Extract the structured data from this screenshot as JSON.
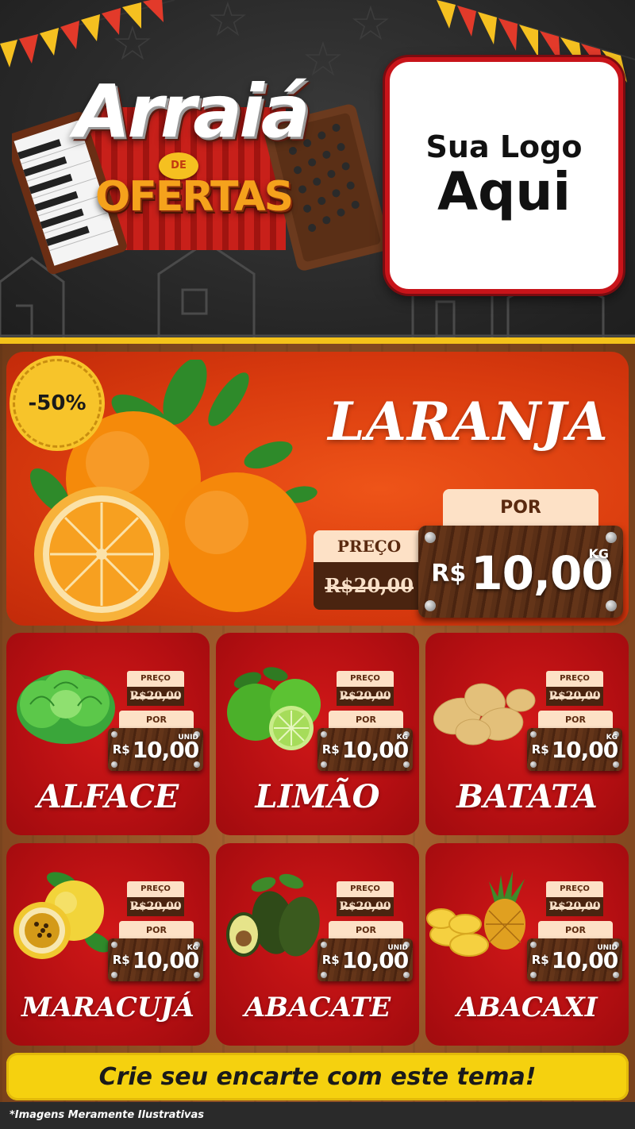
{
  "header": {
    "title_line1": "Arraiá",
    "title_connector": "DE",
    "title_line2": "OFERTAS",
    "logo_line1": "Sua Logo",
    "logo_line2": "Aqui"
  },
  "featured": {
    "discount": "-50%",
    "name": "LARANJA",
    "por_label": "POR",
    "preco_label": "PREÇO",
    "old_price": "R$20,00",
    "currency": "R$",
    "price": "10,00",
    "unit": "KG",
    "image_icon": "orange-icon"
  },
  "products": [
    {
      "name": "ALFACE",
      "preco_label": "PREÇO",
      "old_price": "R$20,00",
      "por_label": "POR",
      "currency": "R$",
      "price": "10,00",
      "unit": "UNID",
      "image_icon": "lettuce-icon"
    },
    {
      "name": "LIMÃO",
      "preco_label": "PREÇO",
      "old_price": "R$20,00",
      "por_label": "POR",
      "currency": "R$",
      "price": "10,00",
      "unit": "KG",
      "image_icon": "lime-icon"
    },
    {
      "name": "BATATA",
      "preco_label": "PREÇO",
      "old_price": "R$20,00",
      "por_label": "POR",
      "currency": "R$",
      "price": "10,00",
      "unit": "KG",
      "image_icon": "potato-icon"
    },
    {
      "name": "MARACUJÁ",
      "preco_label": "PREÇO",
      "old_price": "R$20,00",
      "por_label": "POR",
      "currency": "R$",
      "price": "10,00",
      "unit": "KG",
      "image_icon": "passion-fruit-icon"
    },
    {
      "name": "ABACATE",
      "preco_label": "PREÇO",
      "old_price": "R$20,00",
      "por_label": "POR",
      "currency": "R$",
      "price": "10,00",
      "unit": "UNID",
      "image_icon": "avocado-icon"
    },
    {
      "name": "ABACAXI",
      "preco_label": "PREÇO",
      "old_price": "R$20,00",
      "por_label": "POR",
      "currency": "R$",
      "price": "10,00",
      "unit": "UNID",
      "image_icon": "pineapple-icon"
    }
  ],
  "cta": "Crie seu encarte com este tema!",
  "disclaimer": "*Imagens Meramente Ilustrativas",
  "colors": {
    "header_bg": "#2a2a2a",
    "accent_yellow": "#f5d10f",
    "featured_orange": "#e0440f",
    "card_red": "#b50f12",
    "wood_brown": "#4a2410",
    "label_cream": "#fde1c6"
  }
}
